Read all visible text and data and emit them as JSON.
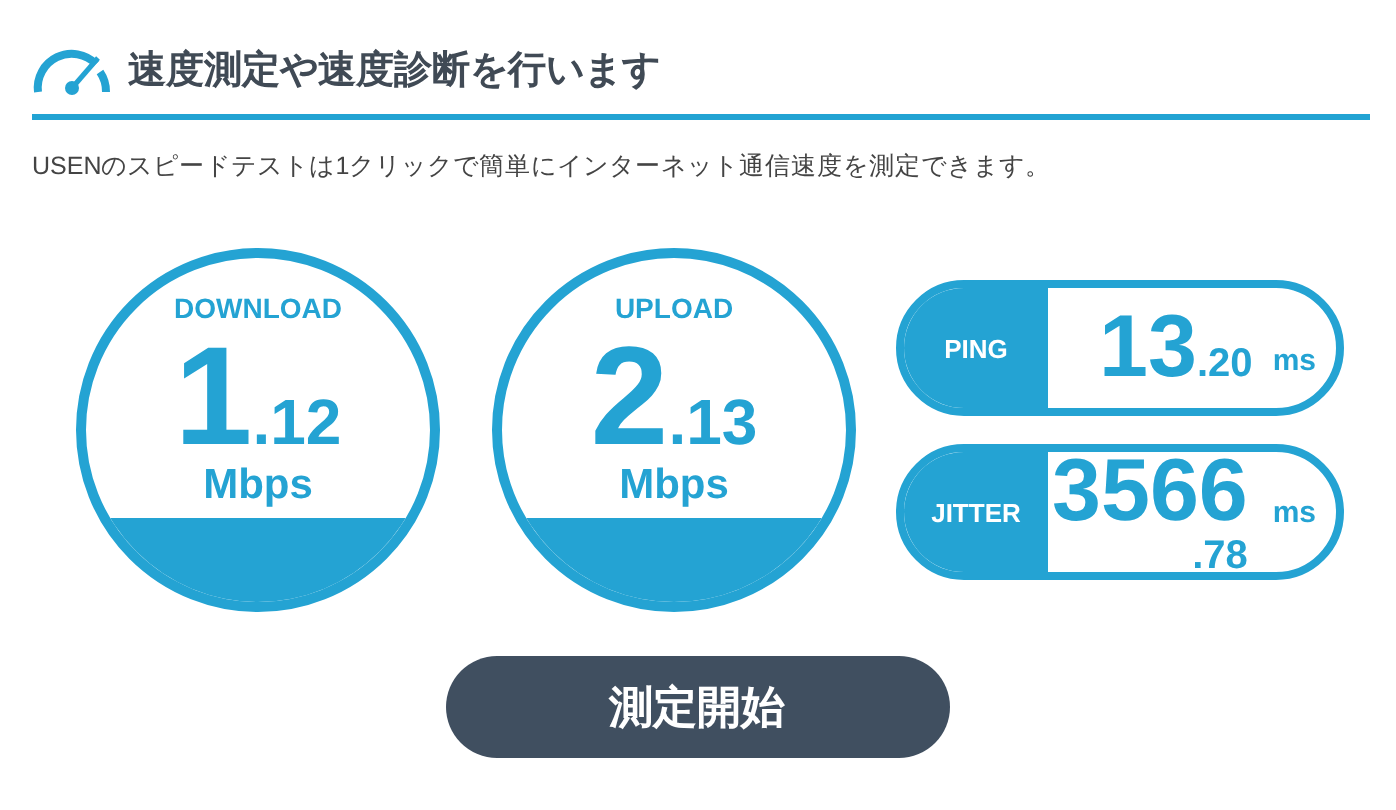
{
  "header": {
    "title": "速度測定や速度診断を行います"
  },
  "description": "USENのスピードテストは1クリックで簡単にインターネット通信速度を測定できます。",
  "gauges": [
    {
      "label": "DOWNLOAD",
      "integer": "1",
      "decimal": ".12",
      "unit": "Mbps"
    },
    {
      "label": "UPLOAD",
      "integer": "2",
      "decimal": ".13",
      "unit": "Mbps"
    }
  ],
  "metrics": [
    {
      "kind": "inline",
      "label": "PING",
      "integer": "13",
      "decimal": ".20",
      "unit": "ms"
    },
    {
      "kind": "stacked",
      "label": "JITTER",
      "integer": "3566",
      "decimal": ".78",
      "unit": "ms"
    }
  ],
  "start_button": {
    "label": "測定開始"
  }
}
